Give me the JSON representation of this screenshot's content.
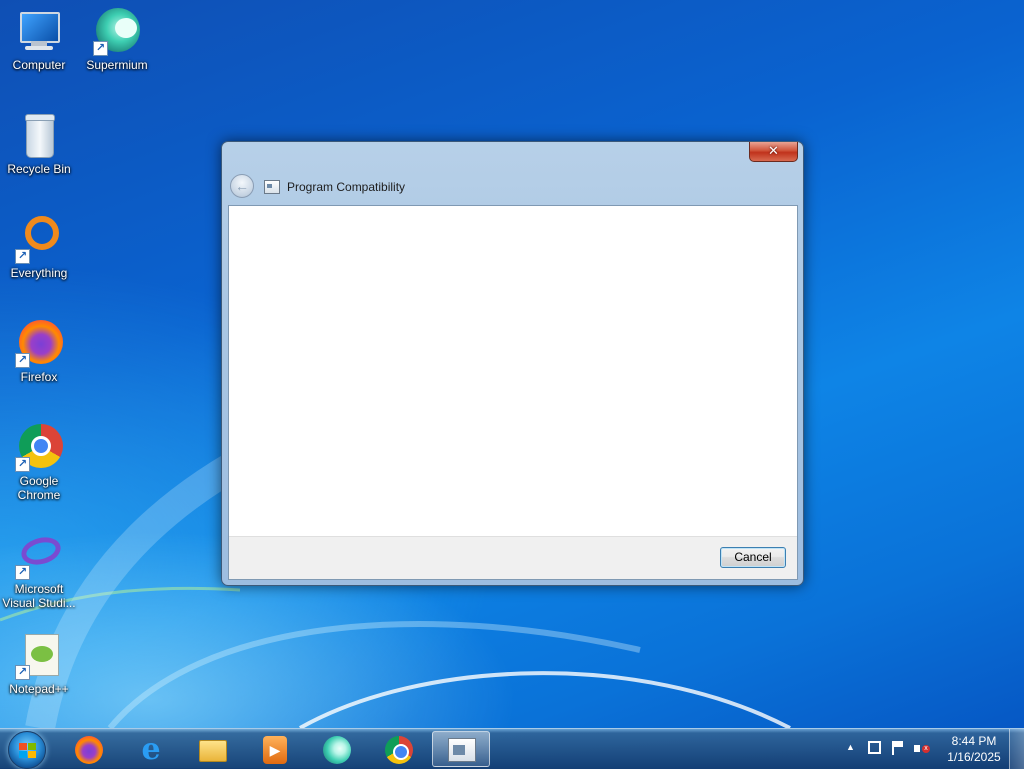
{
  "desktop": {
    "icons": [
      {
        "label": "Computer",
        "icon": "computer-icon"
      },
      {
        "label": "Supermium",
        "icon": "supermium-icon"
      },
      {
        "label": "Recycle Bin",
        "icon": "recycle-bin-icon"
      },
      {
        "label": "Everything",
        "icon": "everything-icon"
      },
      {
        "label": "Firefox",
        "icon": "firefox-icon"
      },
      {
        "label_line1": "Google",
        "label_line2": "Chrome",
        "icon": "chrome-icon"
      },
      {
        "label_line1": "Microsoft",
        "label_line2": "Visual Studi...",
        "icon": "visual-studio-icon"
      },
      {
        "label": "Notepad++",
        "icon": "notepadpp-icon"
      }
    ]
  },
  "dialog": {
    "title": "Program Compatibility",
    "close_label": "✕",
    "back_glyph": "←",
    "cancel_label": "Cancel"
  },
  "taskbar": {
    "pinned": [
      "start-button",
      "firefox",
      "internet-explorer",
      "file-explorer",
      "media-player",
      "supermium",
      "chrome",
      "program-compatibility"
    ],
    "active": "program-compatibility"
  },
  "tray": {
    "time": "8:44 PM",
    "date": "1/16/2025",
    "show_hidden_glyph": "▲"
  }
}
